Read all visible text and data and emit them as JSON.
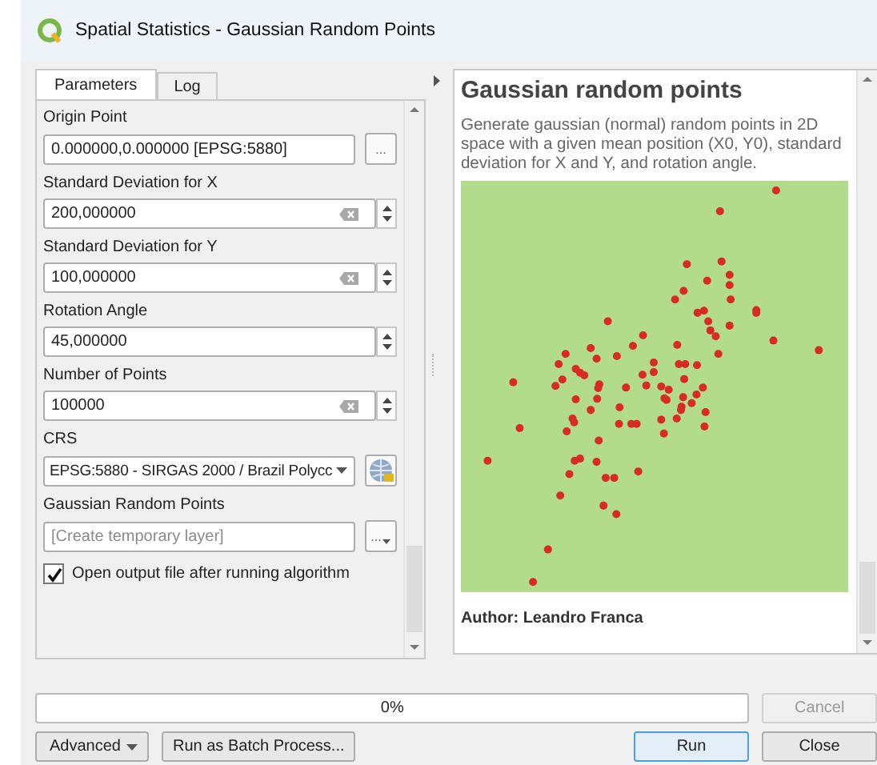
{
  "window": {
    "title": "Spatial Statistics - Gaussian Random Points"
  },
  "tabs": [
    {
      "label": "Parameters",
      "selected": true
    },
    {
      "label": "Log",
      "selected": false
    }
  ],
  "parameters": [
    {
      "kind": "text",
      "label": "Origin Point",
      "value": "0.000000,0.000000 [EPSG:5880]",
      "button": "..."
    },
    {
      "kind": "spin",
      "label": "Standard Deviation for X",
      "value": "200,000000",
      "clearable": true
    },
    {
      "kind": "spin",
      "label": "Standard Deviation for Y",
      "value": "100,000000",
      "clearable": true
    },
    {
      "kind": "spin",
      "label": "Rotation Angle",
      "value": "45,000000",
      "clearable": false
    },
    {
      "kind": "spin",
      "label": "Number of Points",
      "value": "100000",
      "clearable": true
    },
    {
      "kind": "combo",
      "label": "CRS",
      "value": "EPSG:5880 - SIRGAS 2000 / Brazil Polycc"
    },
    {
      "kind": "output",
      "label": "Gaussian Random Points",
      "placeholder": "[Create temporary layer]",
      "button": "..."
    }
  ],
  "open_output": {
    "label": "Open output file after running algorithm",
    "checked": true
  },
  "help": {
    "title": "Gaussian random points",
    "description": "Generate gaussian (normal) random points in 2D space with a given mean position (X0, Y0), standard deviation for X and Y, and rotation angle.",
    "author": "Author: Leandro Franca"
  },
  "progress": {
    "level": 0,
    "reading": "0%"
  },
  "cancel_button": {
    "label": "Cancel",
    "disabled": true
  },
  "buttons": [
    {
      "kind": "menu",
      "label": "Advanced"
    },
    {
      "kind": "plain",
      "label": "Run as Batch Process..."
    },
    {
      "kind": "default",
      "label": "Run"
    },
    {
      "kind": "plain",
      "label": "Close"
    }
  ]
}
